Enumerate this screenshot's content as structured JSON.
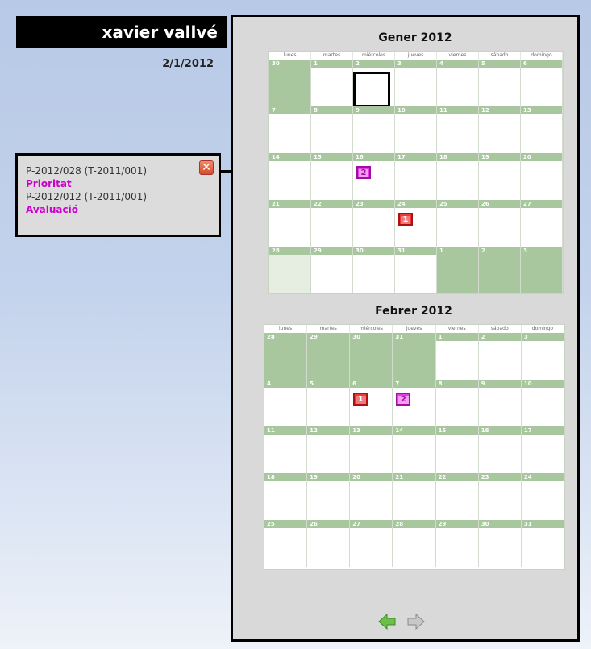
{
  "user": {
    "name": "xavier vallvé",
    "date": "2/1/2012"
  },
  "tooltip": {
    "items": [
      {
        "code": "P-2012/028 (T-2011/001)",
        "tag": "Prioritat"
      },
      {
        "code": "P-2012/012 (T-2011/001)",
        "tag": "Avaluació"
      }
    ]
  },
  "weekdays": [
    "lunes",
    "martes",
    "miércoles",
    "jueves",
    "viernes",
    "sábado",
    "domingo"
  ],
  "calendars": [
    {
      "title": "Gener 2012",
      "weeks": [
        [
          "30",
          "1",
          "2",
          "3",
          "4",
          "5",
          "6"
        ],
        [
          "7",
          "8",
          "9",
          "10",
          "11",
          "12",
          "13"
        ],
        [
          "14",
          "15",
          "16",
          "17",
          "18",
          "19",
          "20"
        ],
        [
          "21",
          "22",
          "23",
          "24",
          "25",
          "26",
          "27"
        ],
        [
          "28",
          "29",
          "30",
          "31",
          "1",
          "2",
          "3"
        ]
      ],
      "events": [
        {
          "week": 2,
          "day": 2,
          "label": "2",
          "type": "Prioritat",
          "color": "#e040e0"
        },
        {
          "week": 3,
          "day": 3,
          "label": "1",
          "type": "Avaluació",
          "color": "#e83a3a"
        }
      ],
      "selected": {
        "week": 0,
        "day": 2
      }
    },
    {
      "title": "Febrer 2012",
      "weeks": [
        [
          "28",
          "29",
          "30",
          "31",
          "1",
          "2",
          "3"
        ],
        [
          "4",
          "5",
          "6",
          "7",
          "8",
          "9",
          "10"
        ],
        [
          "11",
          "12",
          "13",
          "14",
          "15",
          "16",
          "17"
        ],
        [
          "18",
          "19",
          "20",
          "21",
          "22",
          "23",
          "24"
        ],
        [
          "25",
          "26",
          "27",
          "28",
          "29",
          "30",
          "31"
        ]
      ],
      "events": [
        {
          "week": 1,
          "day": 2,
          "label": "1",
          "type": "Avaluació",
          "color": "#e83a3a"
        },
        {
          "week": 1,
          "day": 3,
          "label": "2",
          "type": "Prioritat",
          "color": "#e040e0"
        }
      ]
    }
  ],
  "navigation": {
    "prev_icon": "green-left-arrow-icon",
    "next_icon": "gray-right-arrow-icon"
  }
}
